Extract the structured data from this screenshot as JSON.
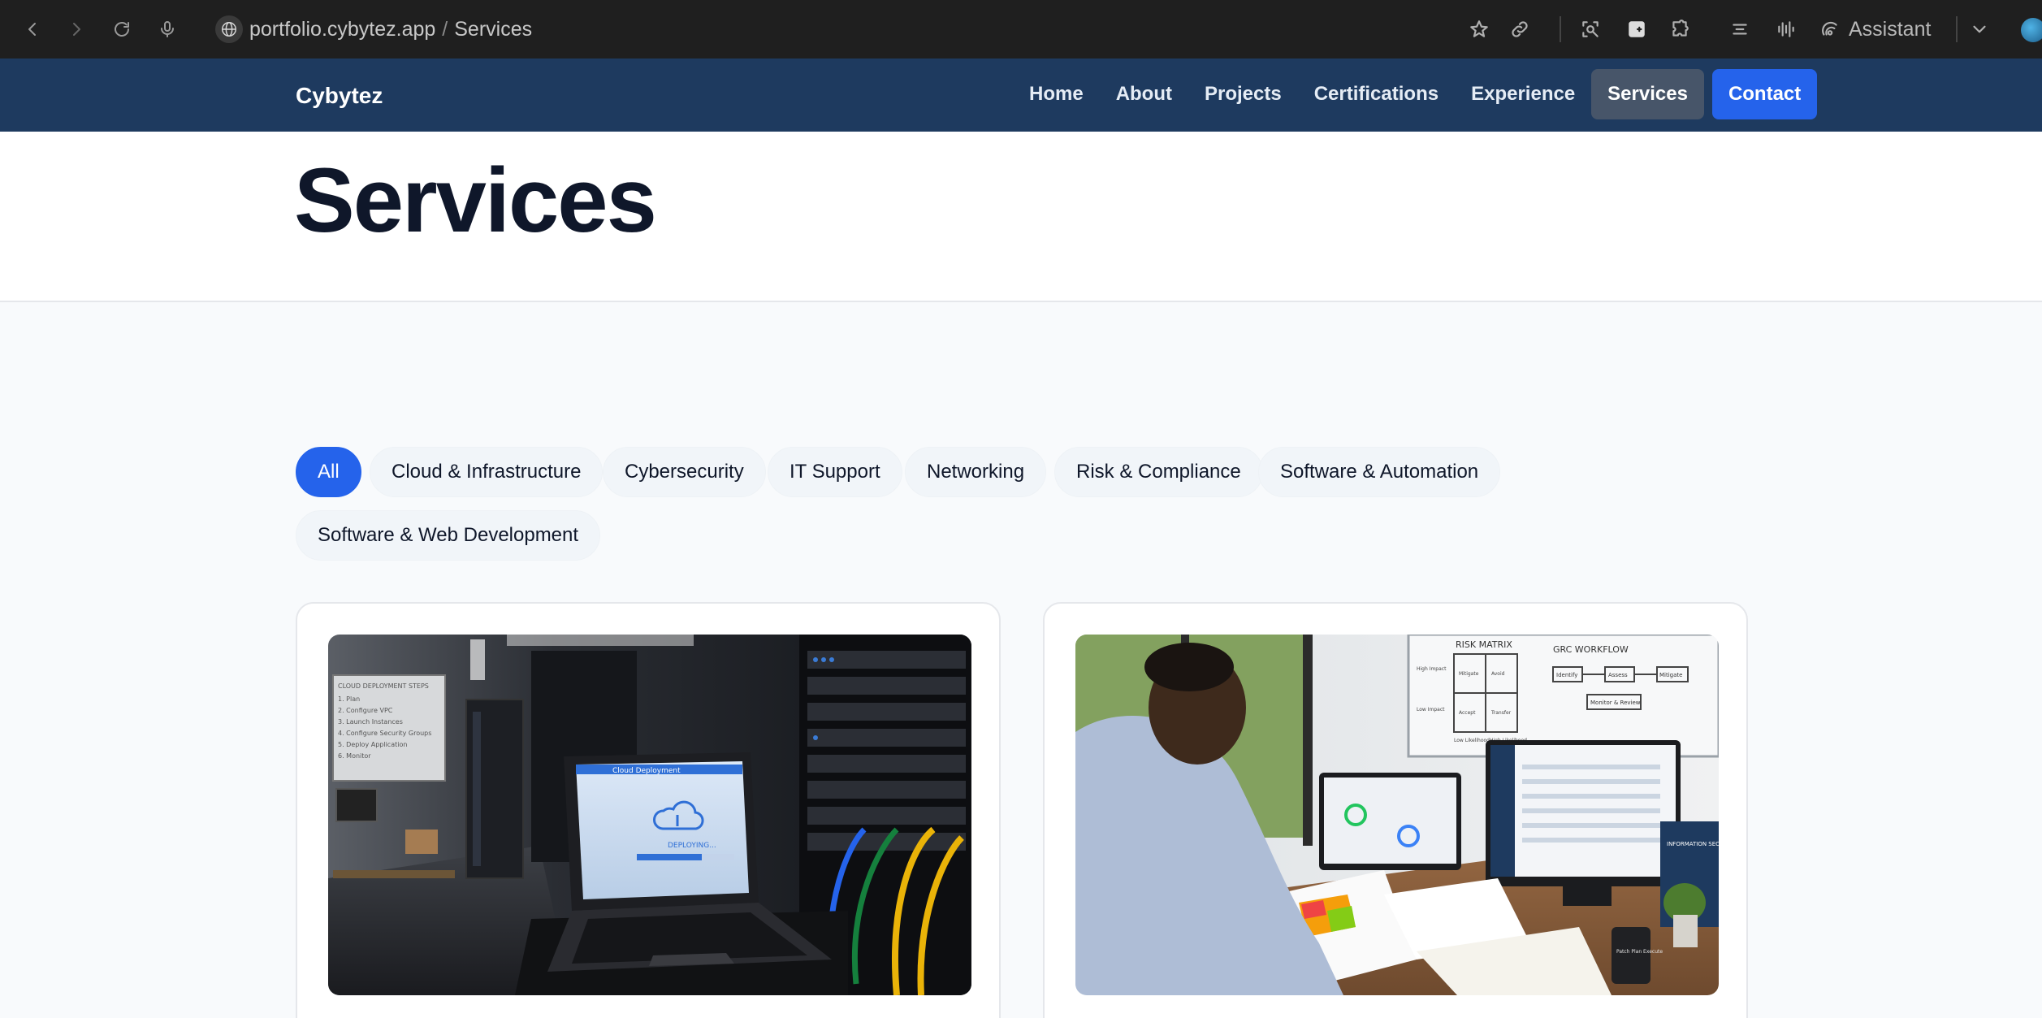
{
  "browser": {
    "url_domain": "portfolio.cybytez.app",
    "url_separator": "/",
    "url_path": "Services",
    "assistant_label": "Assistant"
  },
  "site": {
    "brand": "Cybytez",
    "nav": [
      {
        "label": "Home"
      },
      {
        "label": "About"
      },
      {
        "label": "Projects"
      },
      {
        "label": "Certifications"
      },
      {
        "label": "Experience"
      },
      {
        "label": "Services",
        "active": true
      },
      {
        "label": "Contact",
        "cta": true
      }
    ]
  },
  "page": {
    "title": "Services"
  },
  "filters": [
    {
      "label": "All",
      "active": true
    },
    {
      "label": "Cloud & Infrastructure"
    },
    {
      "label": "Cybersecurity"
    },
    {
      "label": "IT Support"
    },
    {
      "label": "Networking"
    },
    {
      "label": "Risk & Compliance"
    },
    {
      "label": "Software & Automation"
    },
    {
      "label": "Software & Web Development"
    }
  ],
  "cards": [
    {
      "image": "laptop-server-room-cloud-deployment",
      "laptop_title": "Cloud Deployment",
      "laptop_status": "DEPLOYING...",
      "whiteboard_heading": "CLOUD DEPLOYMENT STEPS",
      "whiteboard_steps": [
        "1. Plan",
        "2. Configure VPC",
        "3. Launch Instances",
        "4. Configure Security Groups",
        "5. Deploy Application",
        "6. Monitor"
      ]
    },
    {
      "image": "analyst-reviewing-risk-matrix",
      "whiteboard_left_title": "RISK MATRIX",
      "whiteboard_right_title": "GRC WORKFLOW",
      "matrix_cells": [
        "Mitigate",
        "Avoid",
        "Accept",
        "Transfer"
      ],
      "matrix_axes": [
        "High Impact",
        "Low Impact",
        "Low Likelihood",
        "High Likelihood"
      ],
      "workflow_steps": [
        "Identify",
        "Assess",
        "Mitigate",
        "Monitor & Review"
      ],
      "sign_text": "INFORMATION SECURITY POLICY",
      "mug_text": "Patch Plan Execute"
    }
  ],
  "colors": {
    "chrome_bg": "#1f1f1f",
    "nav_bg": "#1e3a5f",
    "accent": "#2563eb",
    "nav_active": "#475569",
    "page_bg": "#f8fafc"
  }
}
